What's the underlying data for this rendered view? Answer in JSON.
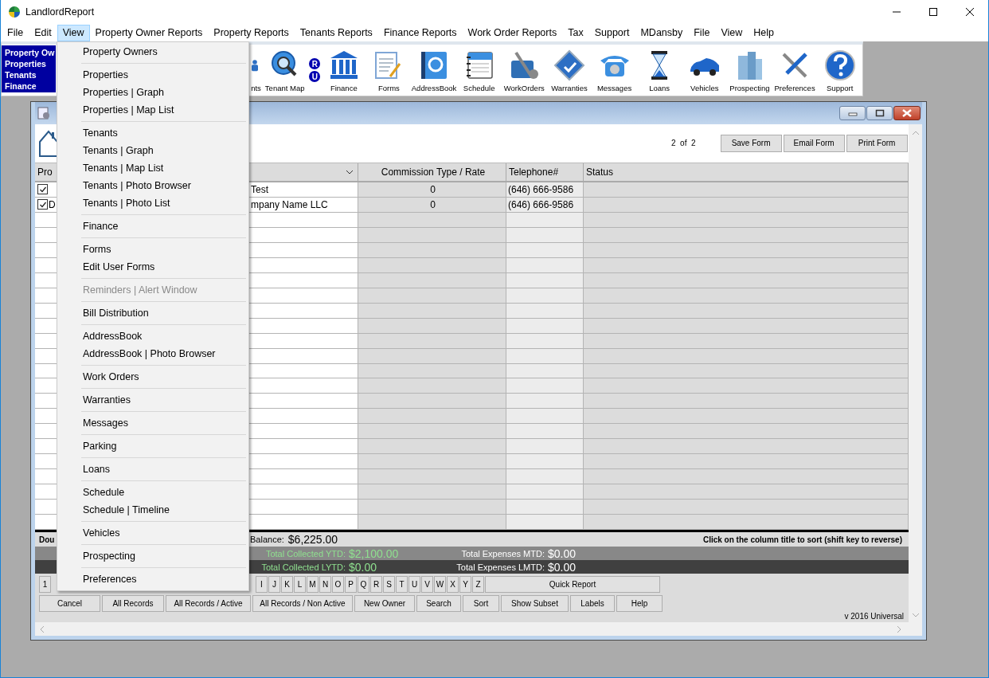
{
  "window": {
    "title": "LandlordReport"
  },
  "menubar": [
    {
      "label": "File",
      "selected": false
    },
    {
      "label": "Edit",
      "selected": false
    },
    {
      "label": "View",
      "selected": true
    },
    {
      "label": "Property Owner Reports",
      "selected": false
    },
    {
      "label": "Property Reports",
      "selected": false
    },
    {
      "label": "Tenants Reports",
      "selected": false
    },
    {
      "label": "Finance Reports",
      "selected": false
    },
    {
      "label": "Work Order Reports",
      "selected": false
    },
    {
      "label": "Tax",
      "selected": false
    },
    {
      "label": "Support",
      "selected": false
    },
    {
      "label": "MDansby",
      "selected": false
    },
    {
      "label": "File",
      "selected": false
    },
    {
      "label": "View",
      "selected": false
    },
    {
      "label": "Help",
      "selected": false
    }
  ],
  "view_menu": [
    [
      {
        "label": "Property Owners",
        "disabled": false
      }
    ],
    [
      {
        "label": "Properties",
        "disabled": false
      },
      {
        "label": "Properties | Graph",
        "disabled": false
      },
      {
        "label": "Properties | Map List",
        "disabled": false
      }
    ],
    [
      {
        "label": "Tenants",
        "disabled": false
      },
      {
        "label": "Tenants | Graph",
        "disabled": false
      },
      {
        "label": "Tenants | Map List",
        "disabled": false
      },
      {
        "label": "Tenants | Photo Browser",
        "disabled": false
      },
      {
        "label": "Tenants | Photo List",
        "disabled": false
      }
    ],
    [
      {
        "label": "Finance",
        "disabled": false
      }
    ],
    [
      {
        "label": "Forms",
        "disabled": false
      },
      {
        "label": "Edit User Forms",
        "disabled": false
      }
    ],
    [
      {
        "label": "Reminders | Alert Window",
        "disabled": true
      }
    ],
    [
      {
        "label": "Bill Distribution",
        "disabled": false
      }
    ],
    [
      {
        "label": "AddressBook",
        "disabled": false
      },
      {
        "label": "AddressBook | Photo Browser",
        "disabled": false
      }
    ],
    [
      {
        "label": "Work Orders",
        "disabled": false
      }
    ],
    [
      {
        "label": "Warranties",
        "disabled": false
      }
    ],
    [
      {
        "label": "Messages",
        "disabled": false
      }
    ],
    [
      {
        "label": "Parking",
        "disabled": false
      }
    ],
    [
      {
        "label": "Loans",
        "disabled": false
      }
    ],
    [
      {
        "label": "Schedule",
        "disabled": false
      },
      {
        "label": "Schedule | Timeline",
        "disabled": false
      }
    ],
    [
      {
        "label": "Vehicles",
        "disabled": false
      }
    ],
    [
      {
        "label": "Prospecting",
        "disabled": false
      }
    ],
    [
      {
        "label": "Preferences",
        "disabled": false
      }
    ]
  ],
  "toolbar": {
    "nav_links": [
      "Property Ow",
      "Properties",
      "Tenants",
      "Finance"
    ],
    "buttons": [
      "nts",
      "Tenant Map",
      "Finance",
      "Forms",
      "AddressBook",
      "Schedule",
      "WorkOrders",
      "Warranties",
      "Messages",
      "Loans",
      "Vehicles",
      "Prospecting",
      "Preferences",
      "Support"
    ],
    "badges": [
      "R",
      "U"
    ]
  },
  "form_window": {
    "pager": "2  of  2",
    "actions": [
      "Save Form",
      "Email Form",
      "Print Form"
    ],
    "columns": [
      {
        "kind": "text",
        "label": "Pro"
      },
      {
        "kind": "dropdown"
      },
      {
        "kind": "text",
        "label": "Commission Type / Rate"
      },
      {
        "kind": "text",
        "label": "Telephone#"
      },
      {
        "kind": "text",
        "label": "Status"
      }
    ],
    "rows": [
      {
        "checked": true,
        "column_2": "Test",
        "commission": "0",
        "telephone": "(646) 666-9586"
      },
      {
        "checked": true,
        "column_1": "D",
        "column_2": "mpany Name LLC",
        "commission": "0",
        "telephone": "(646) 666-9586"
      }
    ],
    "footer_hint": "Dou",
    "balance_label": "Balance:",
    "balance": "$6,225.00",
    "sort_hint": "Click on the column title to sort (shift key to reverse)",
    "totals": [
      {
        "label": "Total Collected YTD:",
        "value": "$2,100.00",
        "expense_label": "Total Expenses MTD:",
        "expense_value": "$0.00"
      },
      {
        "label": "Total Collected LYTD:",
        "value": "$0.00",
        "expense_label": "Total Expenses LMTD:",
        "expense_value": "$0.00"
      }
    ],
    "index_keys": [
      "1",
      "I",
      "J",
      "K",
      "L",
      "M",
      "N",
      "O",
      "P",
      "Q",
      "R",
      "S",
      "T",
      "U",
      "V",
      "W",
      "X",
      "Y",
      "Z"
    ],
    "quick_report": "Quick Report",
    "buttons": [
      "Cancel",
      "All Records",
      "All Records / Active",
      "All Records / Non Active",
      "New Owner",
      "Search",
      "Sort",
      "Show Subset",
      "Labels",
      "Help"
    ],
    "version": "v 2016 Universal"
  }
}
